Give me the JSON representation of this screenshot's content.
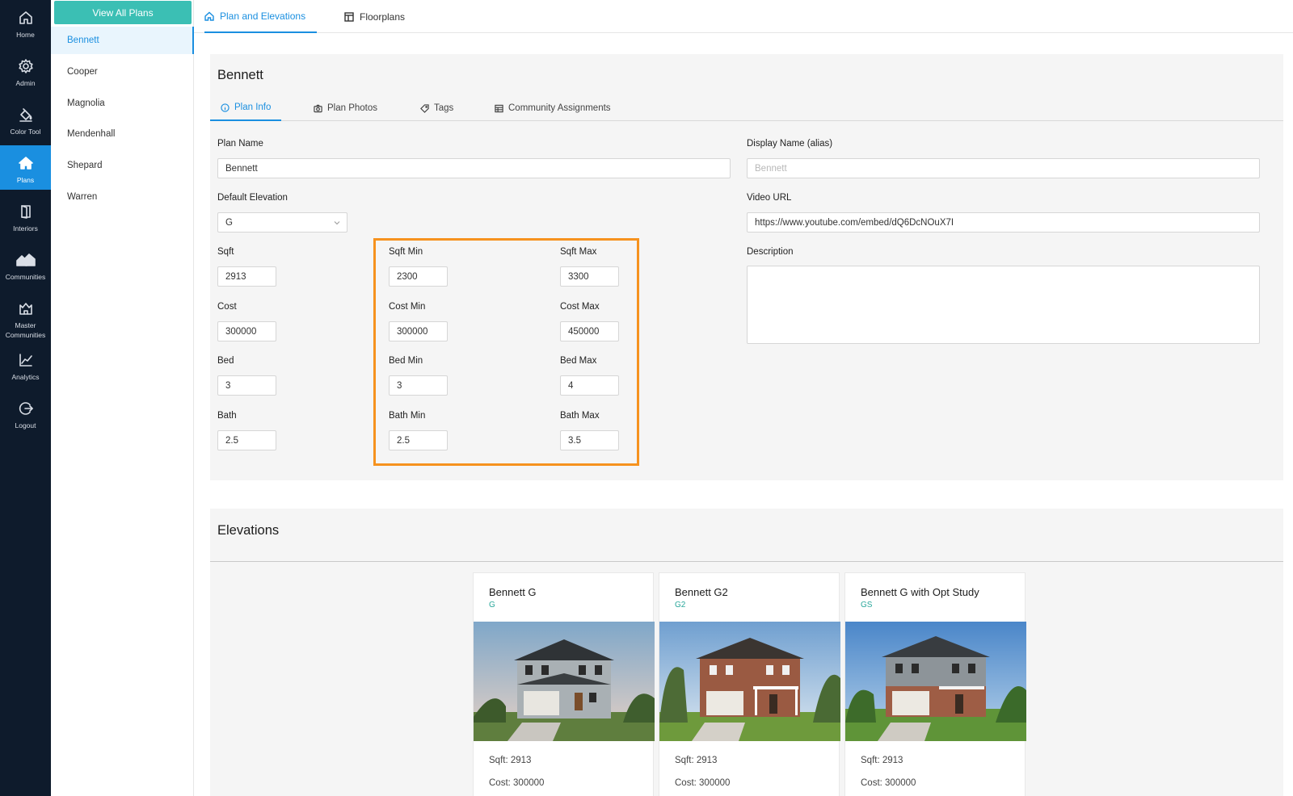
{
  "nav": {
    "items": [
      {
        "label": "Home",
        "icon": "home-icon"
      },
      {
        "label": "Admin",
        "icon": "gear-icon"
      },
      {
        "label": "Color Tool",
        "icon": "paint-bucket-icon"
      },
      {
        "label": "Plans",
        "icon": "house-icon"
      },
      {
        "label": "Interiors",
        "icon": "door-icon"
      },
      {
        "label": "Communities",
        "icon": "houses-icon"
      },
      {
        "label": "Master Communities",
        "icon": "crown-house-icon"
      },
      {
        "label": "Analytics",
        "icon": "chart-icon"
      },
      {
        "label": "Logout",
        "icon": "logout-icon"
      }
    ],
    "active": "Plans"
  },
  "plans": {
    "view_all_label": "View All Plans",
    "items": [
      "Bennett",
      "Cooper",
      "Magnolia",
      "Mendenhall",
      "Shepard",
      "Warren"
    ],
    "active": "Bennett"
  },
  "top_tabs": [
    "Plan and Elevations",
    "Floorplans"
  ],
  "plan": {
    "title": "Bennett",
    "tabs": [
      "Plan Info",
      "Plan Photos",
      "Tags",
      "Community Assignments"
    ],
    "fields": {
      "plan_name": {
        "label": "Plan Name",
        "value": "Bennett"
      },
      "display_name": {
        "label": "Display Name (alias)",
        "placeholder": "Bennett"
      },
      "default_elevation": {
        "label": "Default Elevation",
        "value": "G"
      },
      "video_url": {
        "label": "Video URL",
        "value": "https://www.youtube.com/embed/dQ6DcNOuX7I"
      },
      "description": {
        "label": "Description",
        "value": ""
      },
      "sqft": {
        "label": "Sqft",
        "value": "2913"
      },
      "cost": {
        "label": "Cost",
        "value": "300000"
      },
      "bed": {
        "label": "Bed",
        "value": "3"
      },
      "bath": {
        "label": "Bath",
        "value": "2.5"
      },
      "sqft_min": {
        "label": "Sqft Min",
        "value": "2300"
      },
      "sqft_max": {
        "label": "Sqft Max",
        "value": "3300"
      },
      "cost_min": {
        "label": "Cost Min",
        "value": "300000"
      },
      "cost_max": {
        "label": "Cost Max",
        "value": "450000"
      },
      "bed_min": {
        "label": "Bed Min",
        "value": "3"
      },
      "bed_max": {
        "label": "Bed Max",
        "value": "4"
      },
      "bath_min": {
        "label": "Bath Min",
        "value": "2.5"
      },
      "bath_max": {
        "label": "Bath Max",
        "value": "3.5"
      }
    }
  },
  "elevations": {
    "title": "Elevations",
    "items": [
      {
        "name": "Bennett G",
        "code": "G",
        "sqft": "Sqft: 2913",
        "cost": "Cost: 300000"
      },
      {
        "name": "Bennett G2",
        "code": "G2",
        "sqft": "Sqft: 2913",
        "cost": "Cost: 300000"
      },
      {
        "name": "Bennett G with Opt Study",
        "code": "GS",
        "sqft": "Sqft: 2913",
        "cost": "Cost: 300000"
      }
    ]
  },
  "colors": {
    "nav_bg": "#0e1b2c",
    "accent": "#1a8fe0",
    "teal": "#3bbfb4",
    "highlight": "#f6921e"
  }
}
